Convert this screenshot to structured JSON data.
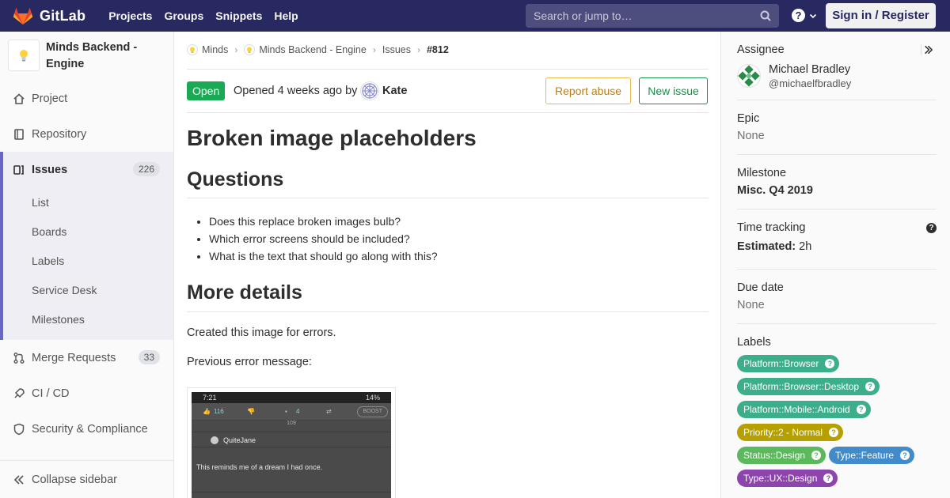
{
  "navbar": {
    "brand": "GitLab",
    "links": [
      "Projects",
      "Groups",
      "Snippets",
      "Help"
    ],
    "search_placeholder": "Search or jump to…",
    "help_glyph": "?",
    "signin": "Sign in / Register"
  },
  "sidebar": {
    "project_name": "Minds Backend - Engine",
    "items": {
      "project": "Project",
      "repository": "Repository",
      "issues": "Issues",
      "issues_count": "226",
      "merge_requests": "Merge Requests",
      "merge_requests_count": "33",
      "cicd": "CI / CD",
      "security": "Security & Compliance"
    },
    "sub_items": [
      "List",
      "Boards",
      "Labels",
      "Service Desk",
      "Milestones"
    ],
    "collapse": "Collapse sidebar"
  },
  "breadcrumbs": {
    "group": "Minds",
    "project": "Minds Backend - Engine",
    "section": "Issues",
    "current": "#812"
  },
  "issue": {
    "status": "Open",
    "opened_text": "Opened 4 weeks ago by",
    "author": "Kate",
    "report_abuse": "Report abuse",
    "new_issue": "New issue",
    "title": "Broken image placeholders",
    "questions_heading": "Questions",
    "questions": [
      "Does this replace broken images bulb?",
      "Which error screens should be included?",
      "What is the text that should go along with this?"
    ],
    "details_heading": "More details",
    "para1": "Created this image for errors.",
    "para2": "Previous error message:",
    "screenshot": {
      "time": "7:21",
      "status": "14%",
      "count1": "116",
      "count2": "4",
      "boost": "BOOST",
      "sub": "109",
      "user": "QuiteJane",
      "text": "This reminds me of a dream I had once."
    }
  },
  "right_sidebar": {
    "assignee_label": "Assignee",
    "assignee_name": "Michael Bradley",
    "assignee_username": "@michaelfbradley",
    "epic_label": "Epic",
    "epic_value": "None",
    "milestone_label": "Milestone",
    "milestone_value": "Misc. Q4 2019",
    "time_label": "Time tracking",
    "time_est_label": "Estimated:",
    "time_est_value": "2h",
    "due_label": "Due date",
    "due_value": "None",
    "labels_label": "Labels",
    "labels": [
      {
        "text": "Platform::Browser",
        "color": "#3cae8c"
      },
      {
        "text": "Platform::Browser::Desktop",
        "color": "#3cae8c"
      },
      {
        "text": "Platform::Mobile::Android",
        "color": "#3cae8c"
      },
      {
        "text": "Priority::2 - Normal",
        "color": "#b5a000"
      },
      {
        "text": "Status::Design",
        "color": "#5cb85c"
      },
      {
        "text": "Type::Feature",
        "color": "#428bca"
      },
      {
        "text": "Type::UX::Design",
        "color": "#8e44ad"
      }
    ]
  }
}
